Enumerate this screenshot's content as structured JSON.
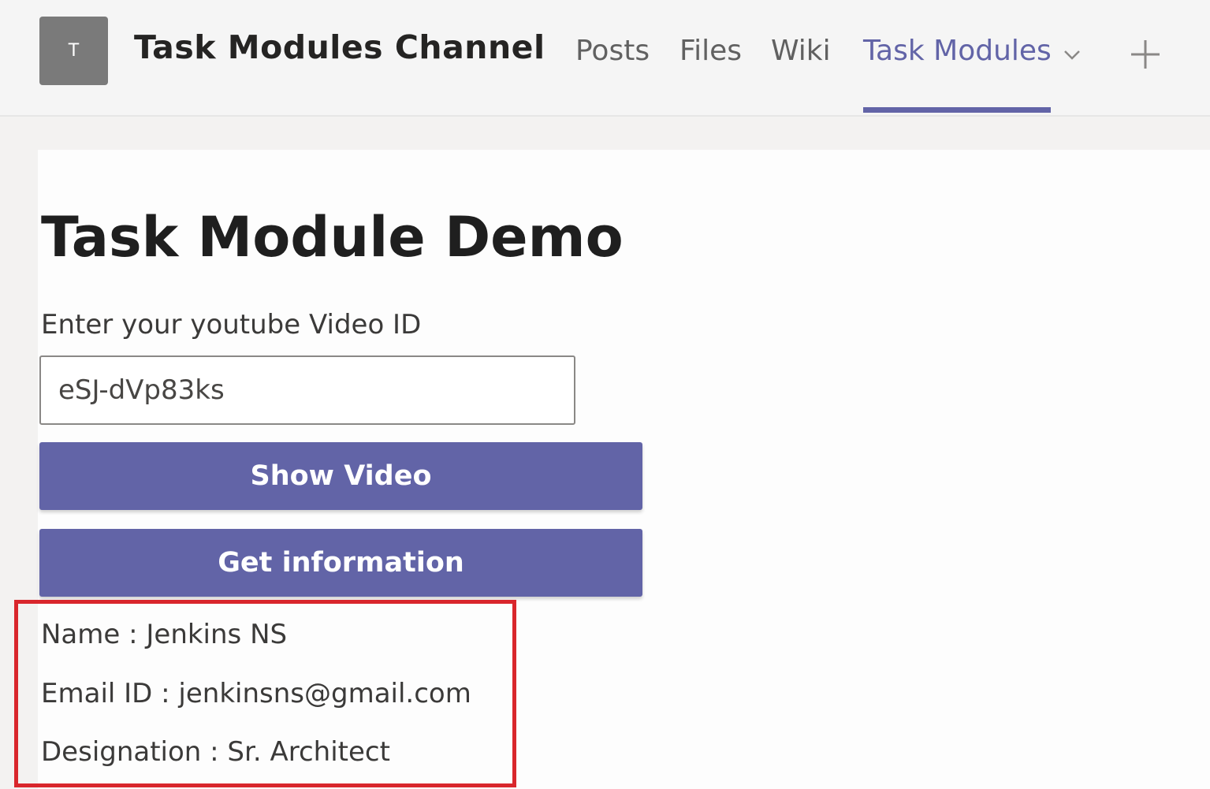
{
  "header": {
    "avatar_letter": "T",
    "channel_title": "Task Modules Channel",
    "tabs": [
      {
        "label": "Posts"
      },
      {
        "label": "Files"
      },
      {
        "label": "Wiki"
      },
      {
        "label": "Task Modules",
        "active": true
      }
    ],
    "icons": {
      "dropdown": "chevron-down-icon",
      "add_tab": "plus-icon"
    }
  },
  "main": {
    "title": "Task Module Demo",
    "video_label": "Enter your youtube Video ID",
    "video_input_value": "eSJ-dVp83ks",
    "show_video_label": "Show Video",
    "get_info_label": "Get information",
    "info": {
      "name": "Name : Jenkins NS",
      "email": "Email ID : jenkinsns@gmail.com",
      "designation": "Designation : Sr. Architect"
    }
  },
  "colors": {
    "accent": "#6264a7",
    "highlight": "#d9262c",
    "avatar": "#7a7a7a"
  }
}
